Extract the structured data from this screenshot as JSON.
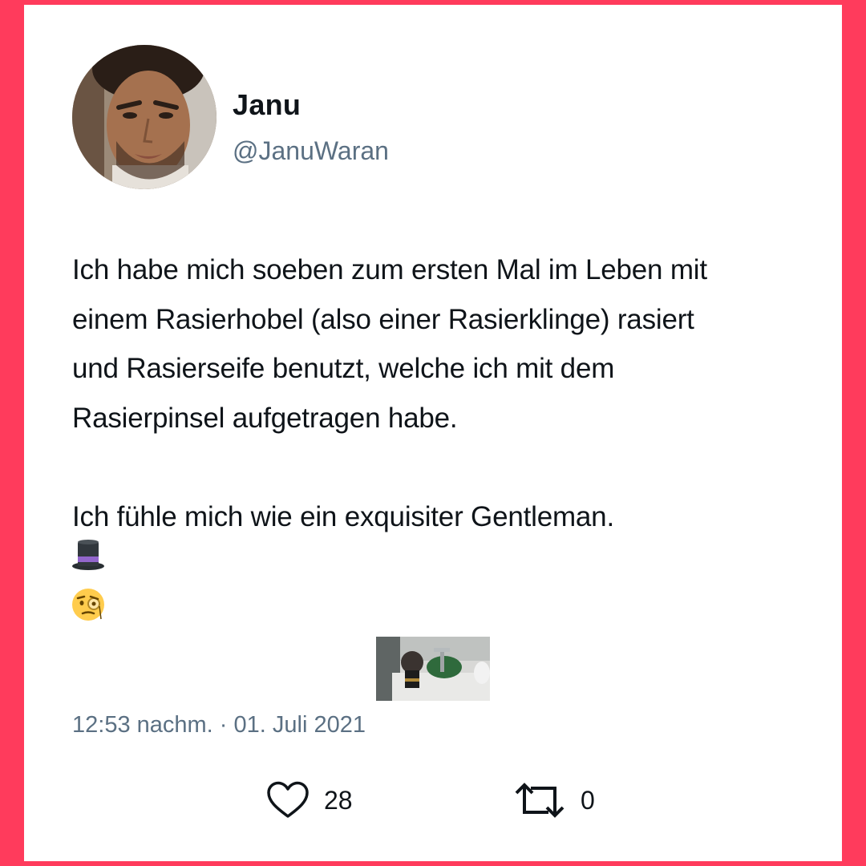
{
  "author": {
    "display_name": "Janu",
    "handle": "@JanuWaran"
  },
  "tweet": {
    "text": "Ich habe mich soeben zum ersten Mal im Leben mit\neinem Rasierhobel (also einer Rasierklinge) rasiert\nund Rasierseife benutzt, welche ich mit dem\nRasierpinsel aufgetragen habe.\n\nIch fühle mich wie ein exquisiter Gentleman.",
    "emojis": [
      "top-hat-emoji",
      "face-with-monocle-emoji"
    ],
    "timestamp": "12:53 nachm. · 01. Juli 2021"
  },
  "actions": {
    "like_count": "28",
    "retweet_count": "0"
  },
  "colors": {
    "frame": "#ff3b5c",
    "card": "#ffffff",
    "text_primary": "#0f1419",
    "text_secondary": "#5b7083"
  }
}
